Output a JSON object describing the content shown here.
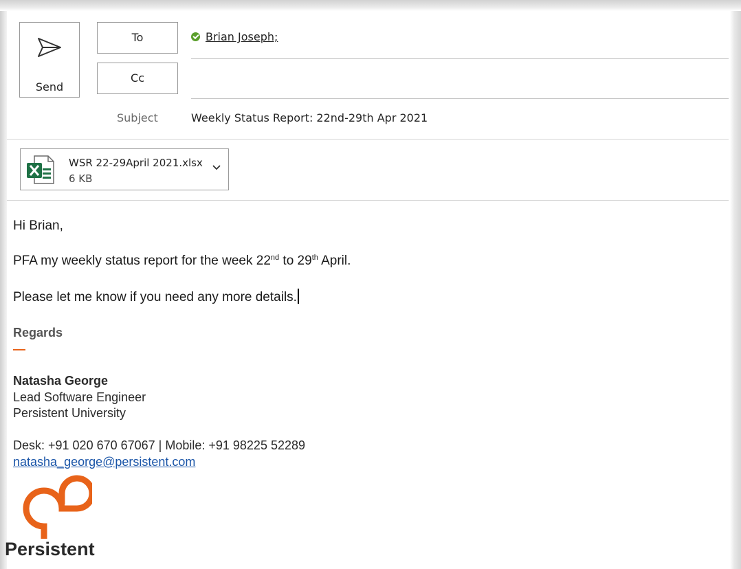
{
  "compose": {
    "send_label": "Send",
    "to_label": "To",
    "cc_label": "Cc",
    "to_recipient": "Brian Joseph;",
    "cc_value": "",
    "subject_label": "Subject",
    "subject_value": "Weekly Status Report: 22nd-29th Apr 2021"
  },
  "attachment": {
    "file_name": "WSR 22-29April 2021.xlsx",
    "file_size": "6 KB",
    "icon": "excel-file-icon"
  },
  "body": {
    "greeting": "Hi Brian,",
    "line1_part1": "PFA my weekly status report for the week 22",
    "line1_sup1": "nd",
    "line1_part2": " to 29",
    "line1_sup2": "th",
    "line1_part3": " April.",
    "line2": "Please let me know if you need any more details."
  },
  "signature": {
    "regards": "Regards",
    "name": "Natasha George",
    "title": "Lead Software Engineer",
    "organization": "Persistent University",
    "contact": "Desk: +91 020 670 67067 | Mobile: +91 98225 52289",
    "email": "natasha_george@persistent.com",
    "logo_text": "Persistent"
  },
  "colors": {
    "accent_orange": "#e8631a",
    "link_blue": "#1a55a8",
    "check_green": "#5a9e2b",
    "excel_green": "#1e7145"
  }
}
